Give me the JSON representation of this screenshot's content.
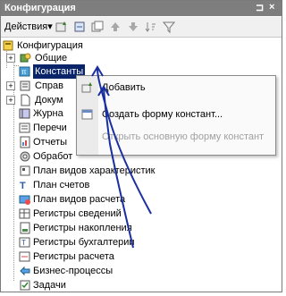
{
  "window": {
    "title": "Конфигурация",
    "pin_glyph": "⊐",
    "close_glyph": "×"
  },
  "toolbar": {
    "actions_label": "Действия▾"
  },
  "tree": {
    "root": "Конфигурация",
    "items": [
      {
        "label": "Общие",
        "icon": "folder-icon"
      },
      {
        "label": "Константы",
        "icon": "constant-icon"
      },
      {
        "label": "Справочники",
        "icon": "catalog-icon"
      },
      {
        "label": "Документы",
        "icon": "document-icon"
      },
      {
        "label": "Журналы документов",
        "icon": "journal-icon"
      },
      {
        "label": "Перечисления",
        "icon": "enum-icon"
      },
      {
        "label": "Отчеты",
        "icon": "report-icon"
      },
      {
        "label": "Обработки",
        "icon": "processing-icon"
      },
      {
        "label": "План видов характеристик",
        "icon": "chart-types-icon"
      },
      {
        "label": "План счетов",
        "icon": "accounts-icon"
      },
      {
        "label": "План видов расчета",
        "icon": "calc-types-icon"
      },
      {
        "label": "Регистры сведений",
        "icon": "info-register-icon"
      },
      {
        "label": "Регистры накопления",
        "icon": "accum-register-icon"
      },
      {
        "label": "Регистры бухгалтерии",
        "icon": "accounting-register-icon"
      },
      {
        "label": "Регистры расчета",
        "icon": "calc-register-icon"
      },
      {
        "label": "Бизнес-процессы",
        "icon": "business-process-icon"
      },
      {
        "label": "Задачи",
        "icon": "task-icon"
      }
    ]
  },
  "tree_visible": {
    "root": "Конфигурация",
    "labels": [
      "Общие",
      "Константы",
      "Справ",
      "Докум",
      "Журна",
      "Перечи",
      "Отчеты",
      "Обработ",
      "План видов характеристик",
      "План счетов",
      "План видов расчета",
      "Регистры сведений",
      "Регистры накопления",
      "Регистры бухгалтерии",
      "Регистры расчета",
      "Бизнес-процессы",
      "Задачи"
    ]
  },
  "context_menu": {
    "items": [
      {
        "label": "Добавить",
        "enabled": true
      },
      {
        "label": "Создать форму констант...",
        "enabled": true
      },
      {
        "label": "Открыть основную форму констант",
        "enabled": false
      }
    ]
  },
  "colors": {
    "titlebar": "#7e7e7e",
    "selection": "#0a246a",
    "annotation_arrow": "#1a2fa0"
  }
}
